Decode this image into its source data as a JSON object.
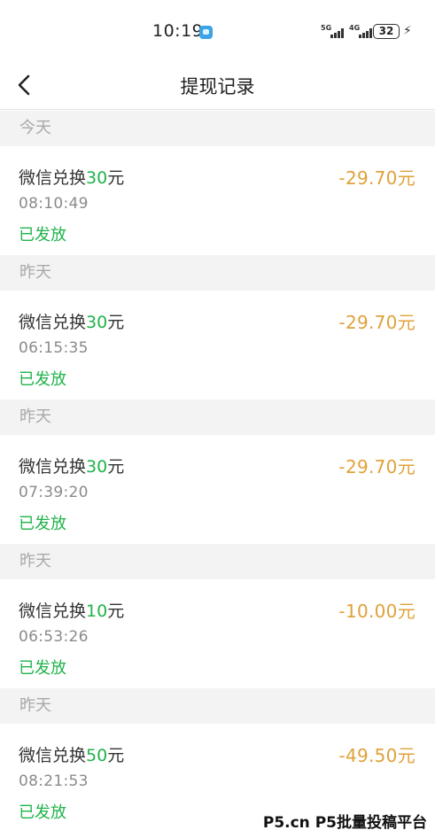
{
  "status_bar": {
    "time": "10:19",
    "signal1": "5G",
    "signal2": "4G",
    "battery": "32"
  },
  "nav": {
    "title": "提现记录"
  },
  "sections": [
    {
      "date": "今天",
      "title_prefix": "微信兑换",
      "title_amount": "30",
      "title_suffix": "元",
      "time": "08:10:49",
      "status": "已发放",
      "change": "-29.70元"
    },
    {
      "date": "昨天",
      "title_prefix": "微信兑换",
      "title_amount": "30",
      "title_suffix": "元",
      "time": "06:15:35",
      "status": "已发放",
      "change": "-29.70元"
    },
    {
      "date": "昨天",
      "title_prefix": "微信兑换",
      "title_amount": "30",
      "title_suffix": "元",
      "time": "07:39:20",
      "status": "已发放",
      "change": "-29.70元"
    },
    {
      "date": "昨天",
      "title_prefix": "微信兑换",
      "title_amount": "10",
      "title_suffix": "元",
      "time": "06:53:26",
      "status": "已发放",
      "change": "-10.00元"
    },
    {
      "date": "昨天",
      "title_prefix": "微信兑换",
      "title_amount": "50",
      "title_suffix": "元",
      "time": "08:21:53",
      "status": "已发放",
      "change": "-49.50元"
    }
  ],
  "watermark": "P5.cn P5批量投稿平台",
  "colors": {
    "accent_green": "#1fb34a",
    "amount_orange": "#e0a23a"
  }
}
